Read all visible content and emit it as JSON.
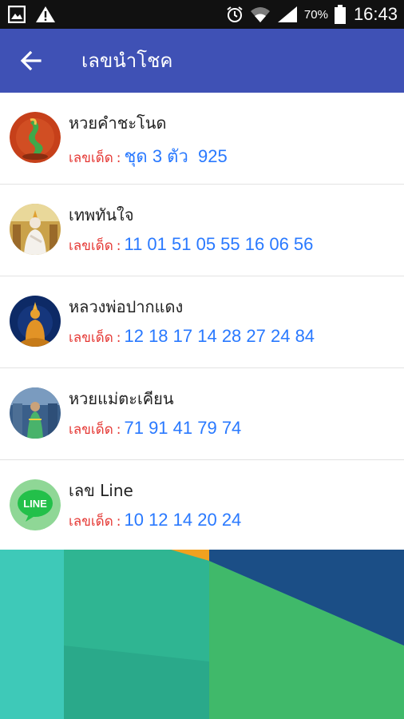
{
  "status_bar": {
    "battery_percent": "70%",
    "time": "16:43",
    "icons": [
      "image-icon",
      "warning-icon",
      "alarm-icon",
      "wifi-icon",
      "signal-icon",
      "battery-icon"
    ]
  },
  "app_bar": {
    "title": "เลขนำโชค",
    "back_icon": "arrow-left-icon"
  },
  "items": [
    {
      "name": "หวยคำชะโนด",
      "label": "เลขเด็ด",
      "numbers": "ชุด 3 ตัว  925",
      "icon": "naga-avatar"
    },
    {
      "name": "เทพทันใจ",
      "label": "เลขเด็ด",
      "numbers": "11 01 51 05 55 16 06 56",
      "icon": "deity-avatar"
    },
    {
      "name": "หลวงพ่อปากแดง",
      "label": "เลขเด็ด",
      "numbers": "12 18 17 14 28 27 24 84",
      "icon": "buddha-avatar"
    },
    {
      "name": "หวยแม่ตะเคียน",
      "label": "เลขเด็ด",
      "numbers": "71 91 41 79 74",
      "icon": "tree-spirit-avatar"
    },
    {
      "name": "เลข Line",
      "label": "เลขเด็ด",
      "numbers": "10 12 14 20 24",
      "icon": "line-logo-avatar",
      "logo_text": "LINE"
    }
  ],
  "colors": {
    "app_bar": "#3f51b5",
    "label_red": "#e53935",
    "number_blue": "#2979ff"
  }
}
